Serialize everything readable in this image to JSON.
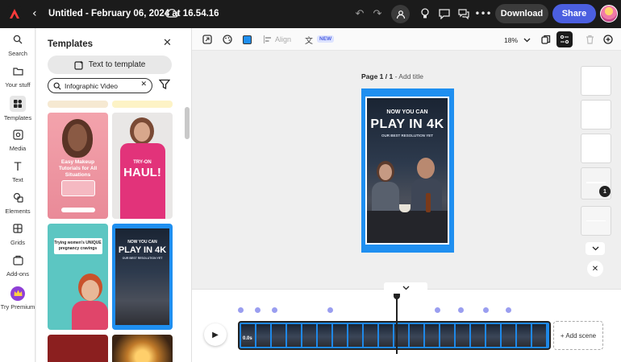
{
  "topbar": {
    "doc_title": "Untitled - February 06, 2024 at 16.54.16",
    "download_label": "Download",
    "share_label": "Share",
    "icons": [
      "back-icon",
      "cloud-sync-icon",
      "undo-icon",
      "redo-icon",
      "share-user-icon",
      "lightbulb-icon",
      "comment-icon",
      "chat-icon",
      "more-icon"
    ]
  },
  "rail": {
    "items": [
      {
        "label": "Search",
        "icon": "search-icon"
      },
      {
        "label": "Your stuff",
        "icon": "folder-icon"
      },
      {
        "label": "Templates",
        "icon": "templates-icon"
      },
      {
        "label": "Media",
        "icon": "media-icon"
      },
      {
        "label": "Text",
        "icon": "text-icon"
      },
      {
        "label": "Elements",
        "icon": "elements-icon"
      },
      {
        "label": "Grids",
        "icon": "grids-icon"
      },
      {
        "label": "Add-ons",
        "icon": "addons-icon"
      },
      {
        "label": "Try Premium",
        "icon": "crown-icon"
      }
    ]
  },
  "panel": {
    "title": "Templates",
    "text_to_template_label": "Text to template",
    "search_value": "Infographic Video",
    "thumbnails": {
      "makeup": {
        "line1": "Easy Makeup",
        "line2": "Tutorials for All",
        "line3": "Situations"
      },
      "haul": {
        "line1": "TRY-ON",
        "line2": "HAUL!"
      },
      "pregnancy": {
        "line1": "Trying women's UNIQUE",
        "line2": "pregnancy cravings"
      },
      "play4k": {
        "line1": "NOW YOU CAN",
        "line2": "PLAY IN 4K",
        "line3": "OUR BEST RESOLUTION YET"
      }
    }
  },
  "toolbar": {
    "align_label": "Align",
    "new_badge": "NEW",
    "zoom": "18%"
  },
  "canvas": {
    "page_label_bold": "Page 1 / 1",
    "page_label_rest": " - Add title",
    "page_text": {
      "line1": "NOW YOU CAN",
      "line2": "PLAY IN 4K",
      "line3": "OUR BEST RESOLUTION YET"
    },
    "page_badge": "1"
  },
  "timeline": {
    "strip_length": "0.0s",
    "add_scene_label": "+ Add scene"
  },
  "colors": {
    "accent": "#4b5fe0",
    "page_border": "#1f8ff0",
    "topbar": "#1b1b1b"
  }
}
